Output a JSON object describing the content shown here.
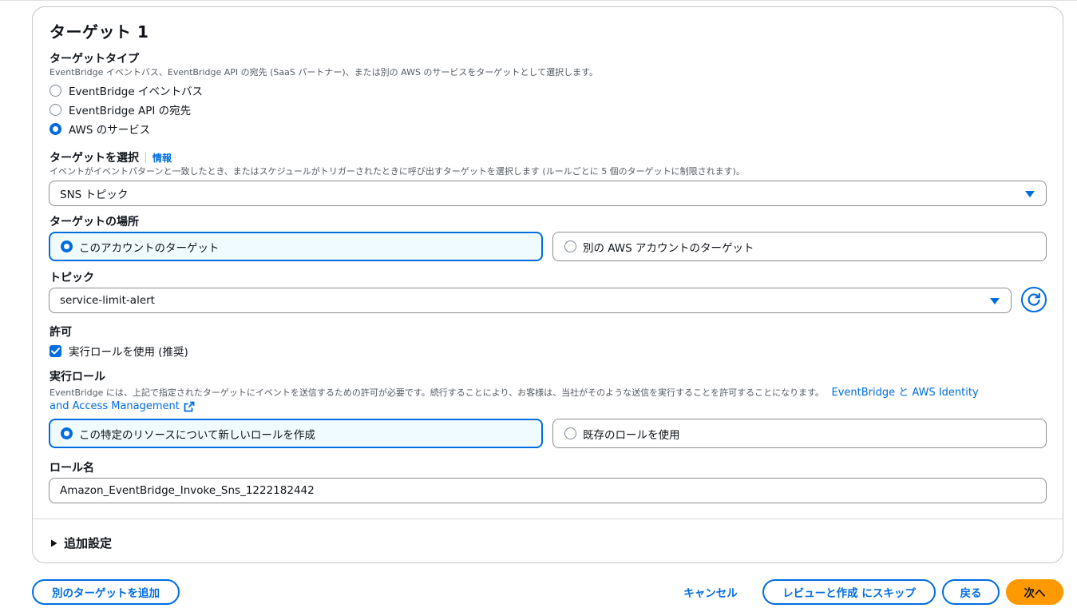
{
  "card": {
    "title": "ターゲット 1",
    "target_type": {
      "label": "ターゲットタイプ",
      "description": "EventBridge イベントバス、EventBridge API の宛先 (SaaS パートナー)、または別の AWS のサービスをターゲットとして選択します。",
      "options": [
        "EventBridge イベントバス",
        "EventBridge API の宛先",
        "AWS のサービス"
      ],
      "selected": "AWS のサービス"
    },
    "select_target": {
      "label": "ターゲットを選択",
      "info_link": "情報",
      "description": "イベントがイベントパターンと一致したとき、またはスケジュールがトリガーされたときに呼び出すターゲットを選択します (ルールごとに 5 個のターゲットに制限されます)。",
      "value": "SNS トピック"
    },
    "target_location": {
      "label": "ターゲットの場所",
      "options": [
        "このアカウントのターゲット",
        "別の AWS アカウントのターゲット"
      ],
      "selected": "このアカウントのターゲット"
    },
    "topic": {
      "label": "トピック",
      "value": "service-limit-alert"
    },
    "permission": {
      "label": "許可",
      "checkbox_label": "実行ロールを使用 (推奨)",
      "checked": true
    },
    "execution_role": {
      "label": "実行ロール",
      "description": "EventBridge には、上記で指定されたターゲットにイベントを送信するための許可が必要です。続行することにより、お客様は、当社がそのような送信を実行することを許可することになります。",
      "link_part1": "EventBridge と AWS Identity",
      "link_part2": "and Access Management",
      "options": [
        "この特定のリソースについて新しいロールを作成",
        "既存のロールを使用"
      ],
      "selected": "この特定のリソースについて新しいロールを作成"
    },
    "role_name": {
      "label": "ロール名",
      "value": "Amazon_EventBridge_Invoke_Sns_1222182442"
    },
    "additional_settings": "追加設定"
  },
  "footer": {
    "add_target": "別のターゲットを追加",
    "cancel": "キャンセル",
    "skip_review": "レビューと作成 にスキップ",
    "back": "戻る",
    "next": "次へ"
  },
  "colors": {
    "accent": "#006ce0",
    "primary_button": "#ff9900",
    "selected_tile_bg": "#f0fbff"
  }
}
